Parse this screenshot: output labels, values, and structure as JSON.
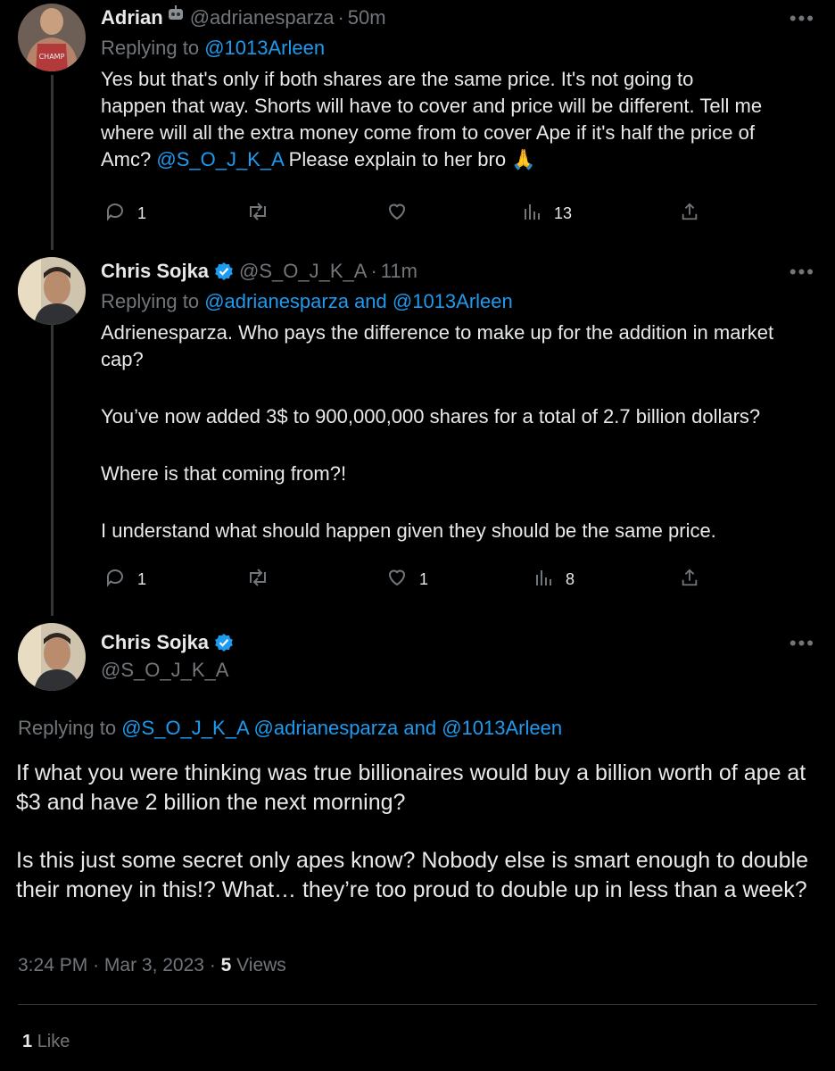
{
  "tweets": [
    {
      "name": "Adrian",
      "handle": "@adrianesparza",
      "time": "50m",
      "replying_prefix": "Replying to",
      "replying_to": "@1013Arleen",
      "body_lines": [
        "Yes but that's only if both shares are the same price. It's not going to",
        "happen that way. Shorts will have to cover and price will be different. Tell me",
        "where will all the extra money come from to cover Ape if it's half the price of"
      ],
      "body_last_prefix": "Amc? ",
      "body_mention": "@S_O_J_K_A",
      "body_last_suffix": "  Please explain to her bro 🙏",
      "replies": "1",
      "retweets": "",
      "likes": "",
      "views": "13"
    },
    {
      "name": "Chris Sojka",
      "handle": "@S_O_J_K_A",
      "time": "11m",
      "replying_prefix": "Replying to",
      "replying_to": "@adrianesparza and @1013Arleen",
      "paragraphs": [
        "Adrienesparza.  Who pays the difference to make up for the addition in market cap?",
        "You’ve now added 3$ to 900,000,000 shares for a total of 2.7 billion dollars?",
        "Where is that coming from?!",
        "I understand what should happen given they should be the same price."
      ],
      "replies": "1",
      "retweets": "",
      "likes": "1",
      "views": "8"
    }
  ],
  "main": {
    "name": "Chris Sojka",
    "handle": "@S_O_J_K_A",
    "replying_prefix": "Replying to",
    "replying_to": "@S_O_J_K_A @adrianesparza and @1013Arleen",
    "paragraphs": [
      "If what you were thinking was true billionaires would buy a billion worth of ape at $3 and have 2 billion the next morning?",
      "Is this just some secret only apes know?  Nobody else is smart enough to double their money in this!?  What… they’re too proud to double up in less than a week?"
    ],
    "time": "3:24 PM",
    "date": "Mar 3, 2023",
    "views_count": "5",
    "views_label": "Views",
    "likes_count": "1",
    "likes_label": "Like"
  },
  "colors": {
    "accent": "#1d9bf0",
    "muted": "#71767b",
    "background": "#000000",
    "text": "#e7e9ea"
  },
  "icons": [
    "reply-icon",
    "retweet-icon",
    "like-icon",
    "views-icon",
    "share-icon",
    "more-icon",
    "verified-badge-icon"
  ]
}
